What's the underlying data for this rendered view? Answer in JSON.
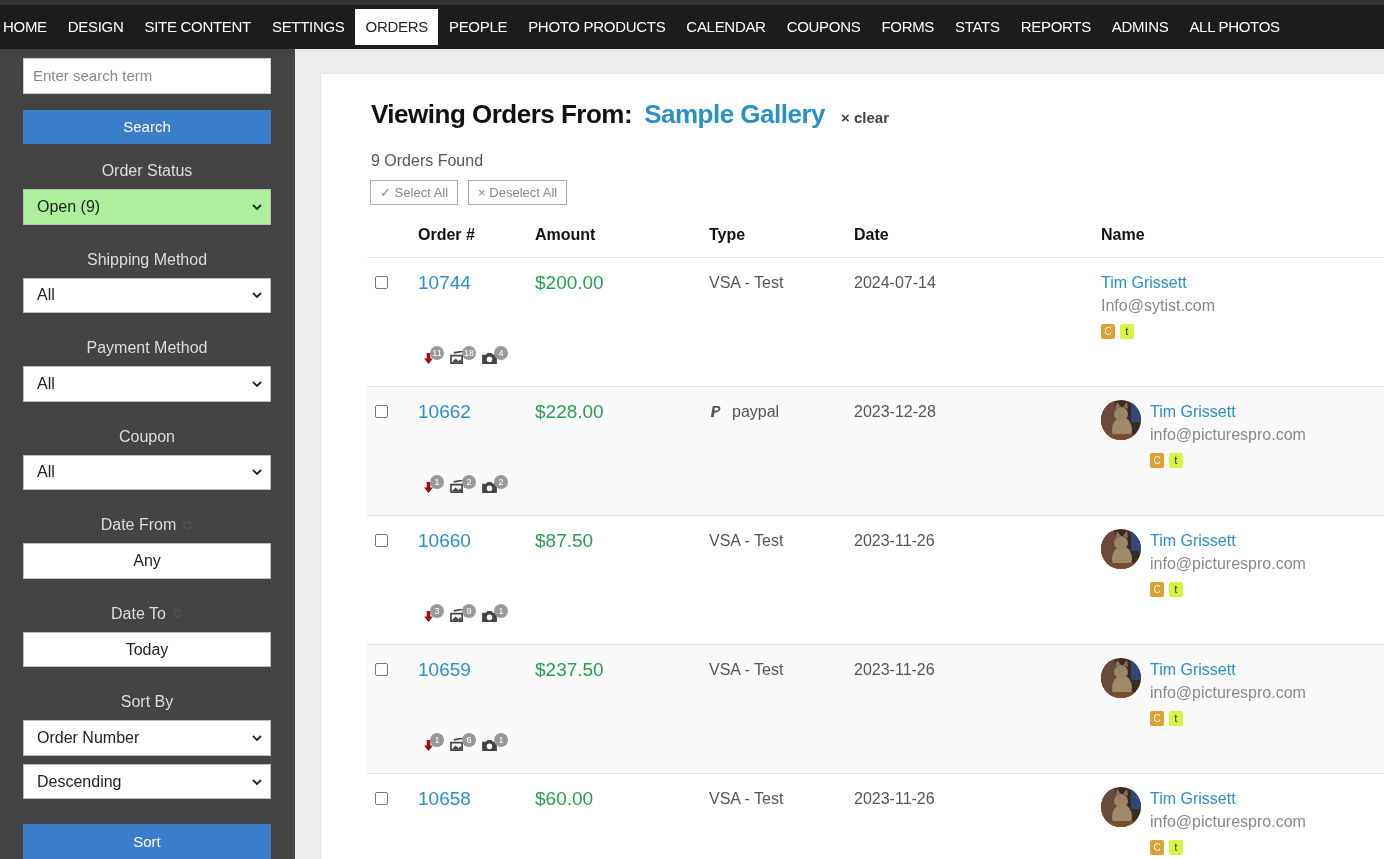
{
  "nav": [
    {
      "label": "HOME",
      "selected": false
    },
    {
      "label": "DESIGN",
      "selected": false
    },
    {
      "label": "SITE CONTENT",
      "selected": false
    },
    {
      "label": "SETTINGS",
      "selected": false
    },
    {
      "label": "ORDERS",
      "selected": true
    },
    {
      "label": "PEOPLE",
      "selected": false
    },
    {
      "label": "PHOTO PRODUCTS",
      "selected": false
    },
    {
      "label": "CALENDAR",
      "selected": false
    },
    {
      "label": "COUPONS",
      "selected": false
    },
    {
      "label": "FORMS",
      "selected": false
    },
    {
      "label": "STATS",
      "selected": false
    },
    {
      "label": "REPORTS",
      "selected": false
    },
    {
      "label": "ADMINS",
      "selected": false
    },
    {
      "label": "ALL PHOTOS",
      "selected": false
    }
  ],
  "sidebar": {
    "search": {
      "placeholder": "Enter search term"
    },
    "search_button": "Search",
    "filters": [
      {
        "label": "Order Status",
        "reset": false,
        "controls": [
          {
            "kind": "select",
            "value": "Open (9)",
            "highlighted": true
          }
        ]
      },
      {
        "label": "Shipping Method",
        "reset": false,
        "controls": [
          {
            "kind": "select",
            "value": "All",
            "highlighted": false
          }
        ]
      },
      {
        "label": "Payment Method",
        "reset": false,
        "controls": [
          {
            "kind": "select",
            "value": "All",
            "highlighted": false
          }
        ]
      },
      {
        "label": "Coupon",
        "reset": false,
        "controls": [
          {
            "kind": "select",
            "value": "All",
            "highlighted": false
          }
        ]
      },
      {
        "label": "Date From",
        "reset": true,
        "controls": [
          {
            "kind": "date",
            "value": "Any",
            "highlighted": false
          }
        ]
      },
      {
        "label": "Date To",
        "reset": true,
        "controls": [
          {
            "kind": "date",
            "value": "Today",
            "highlighted": false
          }
        ]
      },
      {
        "label": "Sort By",
        "reset": false,
        "controls": [
          {
            "kind": "select",
            "value": "Order Number",
            "highlighted": false
          },
          {
            "kind": "select",
            "value": "Descending",
            "highlighted": false
          }
        ]
      }
    ],
    "sort_button": "Sort"
  },
  "main": {
    "heading": "Viewing Orders From:",
    "gallery": "Sample Gallery",
    "clear": "× clear",
    "count": "9 Orders Found",
    "select_all": "✓ Select All",
    "deselect_all": "× Deselect All",
    "columns": [
      "Order #",
      "Amount",
      "Type",
      "Date",
      "Name"
    ],
    "rows": [
      {
        "checked": false,
        "order": "10744",
        "amount": "$200.00",
        "type": {
          "kind": "plain",
          "text": "VSA - Test"
        },
        "date": "2024-07-14",
        "name": "Tim Grissett",
        "email": "Info@sytist.com",
        "tags": [
          {
            "text": "C",
            "color": "#e0a030"
          },
          {
            "text": "t",
            "color": "#d4f542"
          }
        ],
        "downloads": "11",
        "images": "18",
        "photos": "4"
      },
      {
        "checked": false,
        "order": "10662",
        "amount": "$228.00",
        "type": {
          "kind": "paypal",
          "text": "paypal"
        },
        "date": "2023-12-28",
        "name": "Tim Grissett",
        "email": "info@picturespro.com",
        "tags": [
          {
            "text": "C",
            "color": "#e0a030"
          },
          {
            "text": "t",
            "color": "#d4f542"
          }
        ],
        "downloads": "1",
        "images": "2",
        "photos": "2"
      },
      {
        "checked": false,
        "order": "10660",
        "amount": "$87.50",
        "type": {
          "kind": "plain",
          "text": "VSA - Test"
        },
        "date": "2023-11-26",
        "name": "Tim Grissett",
        "email": "info@picturespro.com",
        "tags": [
          {
            "text": "C",
            "color": "#e0a030"
          },
          {
            "text": "t",
            "color": "#d4f542"
          }
        ],
        "downloads": "3",
        "images": "9",
        "photos": "1"
      },
      {
        "checked": false,
        "order": "10659",
        "amount": "$237.50",
        "type": {
          "kind": "plain",
          "text": "VSA - Test"
        },
        "date": "2023-11-26",
        "name": "Tim Grissett",
        "email": "info@picturespro.com",
        "tags": [
          {
            "text": "C",
            "color": "#e0a030"
          },
          {
            "text": "t",
            "color": "#d4f542"
          }
        ],
        "downloads": "1",
        "images": "6",
        "photos": "1"
      },
      {
        "checked": false,
        "order": "10658",
        "amount": "$60.00",
        "type": {
          "kind": "plain",
          "text": "VSA - Test"
        },
        "date": "2023-11-26",
        "name": "Tim Grissett",
        "email": "info@picturespro.com",
        "tags": [
          {
            "text": "C",
            "color": "#e0a030"
          },
          {
            "text": "t",
            "color": "#d4f542"
          }
        ]
      }
    ]
  }
}
